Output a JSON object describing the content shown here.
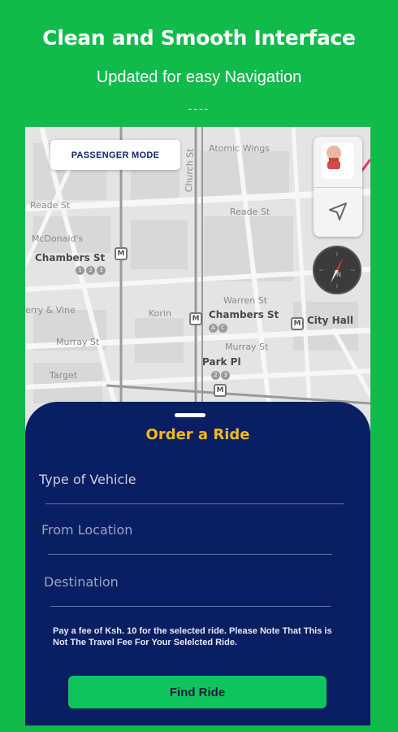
{
  "header": {
    "title": "Clean and Smooth Interface",
    "subtitle": "Updated for easy Navigation",
    "divider": "----"
  },
  "map": {
    "mode_label": "PASSENGER MODE",
    "labels": {
      "atomic_wings": "Atomic Wings",
      "church_st": "Church St",
      "reade_st_left": "Reade St",
      "reade_st_right": "Reade St",
      "mcdonalds": "McDonald's",
      "chambers_st_left": "Chambers St",
      "chambers_st_mid": "Chambers St",
      "berry_vine": "erry & Vine",
      "korin": "Korin",
      "warren_st": "Warren St",
      "city_hall": "City Hall",
      "murray_st_left": "Murray St",
      "murray_st_mid": "Murray St",
      "target": "Target",
      "park_pl": "Park Pl"
    },
    "metro_badges": [
      "1",
      "2",
      "3",
      "A",
      "C",
      "2",
      "3"
    ]
  },
  "order_panel": {
    "title": "Order a Ride",
    "vehicle_placeholder": "Type of Vehicle",
    "from_placeholder": "From Location",
    "destination_placeholder": "Destination",
    "notice": "Pay a fee of Ksh. 10 for the selected ride. Please Note That This is Not The Travel Fee For Your Selelcted Ride.",
    "find_button_label": "Find Ride"
  },
  "colors": {
    "brand_green": "#10bb4b",
    "panel_navy": "#0a1f63",
    "accent_yellow": "#f3b91a",
    "button_green": "#10c45c"
  }
}
